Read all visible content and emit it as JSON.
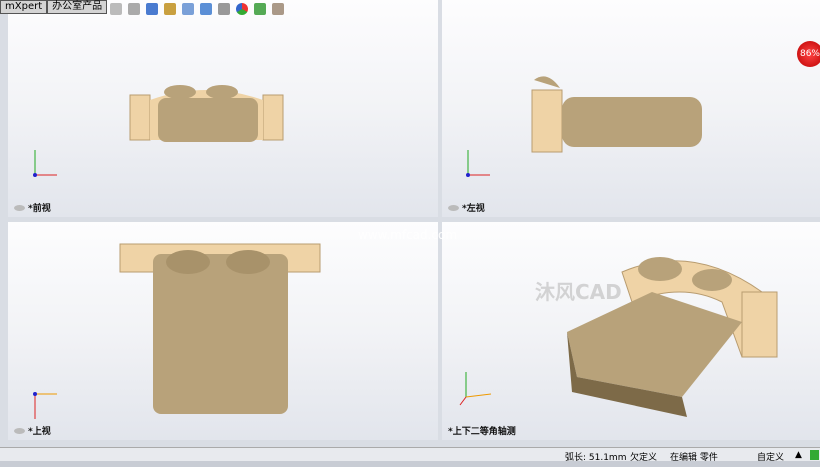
{
  "tabs": [
    "mXpert",
    "办公室产品"
  ],
  "toolbar_icons": [
    "zoom-to-fit-icon",
    "zoom-area-icon",
    "previous-view-icon",
    "section-view-icon",
    "view-orientation-icon",
    "display-style-icon",
    "hide-show-icon",
    "appearance-icon",
    "scene-icon",
    "view-settings-icon"
  ],
  "viewports": {
    "front": "*前视",
    "left": "*左视",
    "top": "*上视",
    "iso": "*上下二等角轴测"
  },
  "badge": "86%",
  "watermark": "www.mfcad.com",
  "watermark_logo": "沐风CAD",
  "status": {
    "arc_length": "弧长: 51.1mm",
    "definition": "欠定义",
    "editing": "在编辑 零件",
    "custom": "自定义",
    "arrow": "▲"
  },
  "colors": {
    "fabric": "#b8a27a",
    "wood": "#efd3a6"
  }
}
